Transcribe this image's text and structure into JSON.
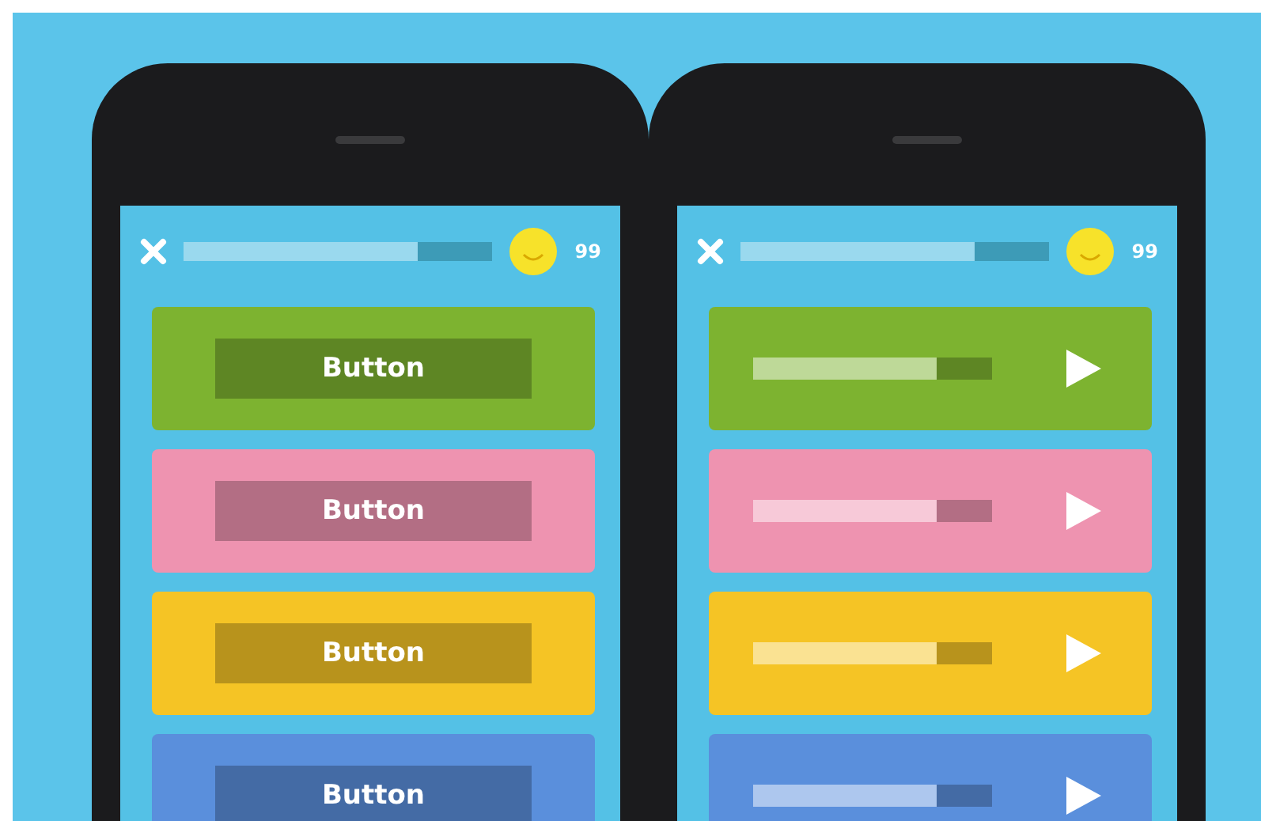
{
  "phones": [
    {
      "progress": {
        "level": 0.76
      },
      "score": "99",
      "cards": [
        {
          "kind": "button",
          "label": "Button",
          "color": "#7db330"
        },
        {
          "kind": "button",
          "label": "Button",
          "color": "#ee93b0"
        },
        {
          "kind": "button",
          "label": "Button",
          "color": "#f5c425"
        },
        {
          "kind": "button",
          "label": "Button",
          "color": "#5a8fdc"
        }
      ]
    },
    {
      "progress": {
        "level": 0.76
      },
      "score": "99",
      "cards": [
        {
          "kind": "audio",
          "level": 0.77,
          "color": "#7db330"
        },
        {
          "kind": "audio",
          "level": 0.77,
          "color": "#ee93b0"
        },
        {
          "kind": "audio",
          "level": 0.77,
          "color": "#f5c425"
        },
        {
          "kind": "audio",
          "level": 0.77,
          "color": "#5a8fdc"
        }
      ]
    }
  ]
}
